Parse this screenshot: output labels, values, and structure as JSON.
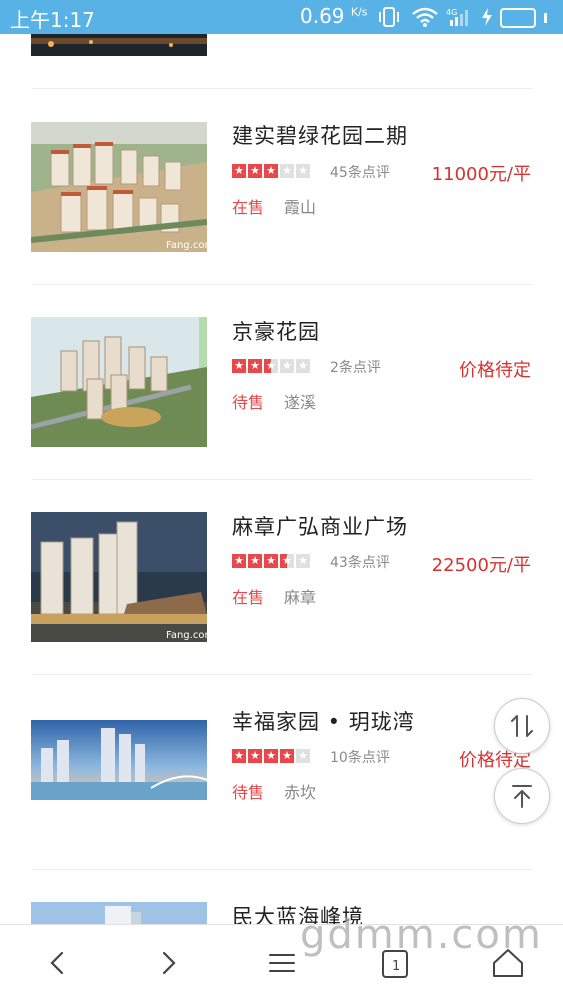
{
  "status_bar": {
    "time": "上午1:17",
    "net_speed": "0.69",
    "net_speed_unit": "K/s",
    "network": "4G",
    "battery_level": 1
  },
  "listings": [
    {
      "title": "建实碧绿花园二期",
      "rating": 3,
      "reviews": "45条点评",
      "price": "11000元/平",
      "status": "在售",
      "district": "霞山"
    },
    {
      "title": "京豪花园",
      "rating": 2.5,
      "reviews": "2条点评",
      "price": "价格待定",
      "status": "待售",
      "district": "遂溪"
    },
    {
      "title": "麻章广弘商业广场",
      "rating": 3.5,
      "reviews": "43条点评",
      "price": "22500元/平",
      "status": "在售",
      "district": "麻章"
    },
    {
      "title": "幸福家园 • 玥珑湾",
      "rating": 4,
      "reviews": "10条点评",
      "price": "价格待定",
      "status": "待售",
      "district": "赤坎"
    },
    {
      "title": "民大蓝海峰境"
    }
  ],
  "thumb_logo": "Fang.com",
  "watermark": "gdmm.com",
  "tab_count": "1",
  "icons": {
    "float_sort": "sort-arrows-icon",
    "float_top": "back-to-top-icon",
    "back": "chevron-left-icon",
    "forward": "chevron-right-icon",
    "menu": "menu-icon",
    "tabs": "tabs-icon",
    "home": "home-icon"
  },
  "colors": {
    "status_bar": "#58b2e6",
    "accent": "#e8484b",
    "price": "#d6332f"
  }
}
